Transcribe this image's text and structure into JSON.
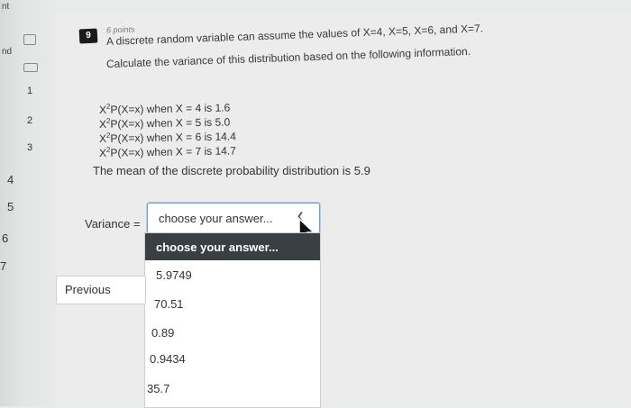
{
  "nav": {
    "top_label": "nt",
    "second_label": "nd",
    "question_numbers": [
      "1",
      "2",
      "3",
      "4",
      "5",
      "6",
      "7"
    ]
  },
  "question": {
    "number": "9",
    "points": "6 points",
    "prompt_line1": "A discrete random variable can assume the values of X=4, X=5, X=6, and X=7.",
    "prompt_line2": "Calculate the variance of this distribution based on the following information.",
    "given": [
      {
        "lead": "X",
        "sup": "2",
        "rest": "P(X=x) when X = 4 is 1.6"
      },
      {
        "lead": "X",
        "sup": "2",
        "rest": "P(X=x) when X = 5 is 5.0"
      },
      {
        "lead": "X",
        "sup": "2",
        "rest": "P(X=x) when X = 6 is 14.4"
      },
      {
        "lead": "X",
        "sup": "2",
        "rest": "P(X=x) when X = 7 is 14.7"
      }
    ],
    "mean_text": "The mean of the discrete probability distribution is 5.9",
    "variance_label": "Variance =",
    "select": {
      "value": "choose your answer...",
      "arrow_icon": "chevron-icon"
    },
    "options": [
      "choose your answer...",
      "5.9749",
      "70.51",
      "0.89",
      "0.9434",
      "35.7"
    ]
  },
  "buttons": {
    "previous": "Previous"
  },
  "colors": {
    "selected_option_bg": "#3a3f44",
    "select_border": "#7a9cc2",
    "badge_bg": "#1a1a1a"
  }
}
